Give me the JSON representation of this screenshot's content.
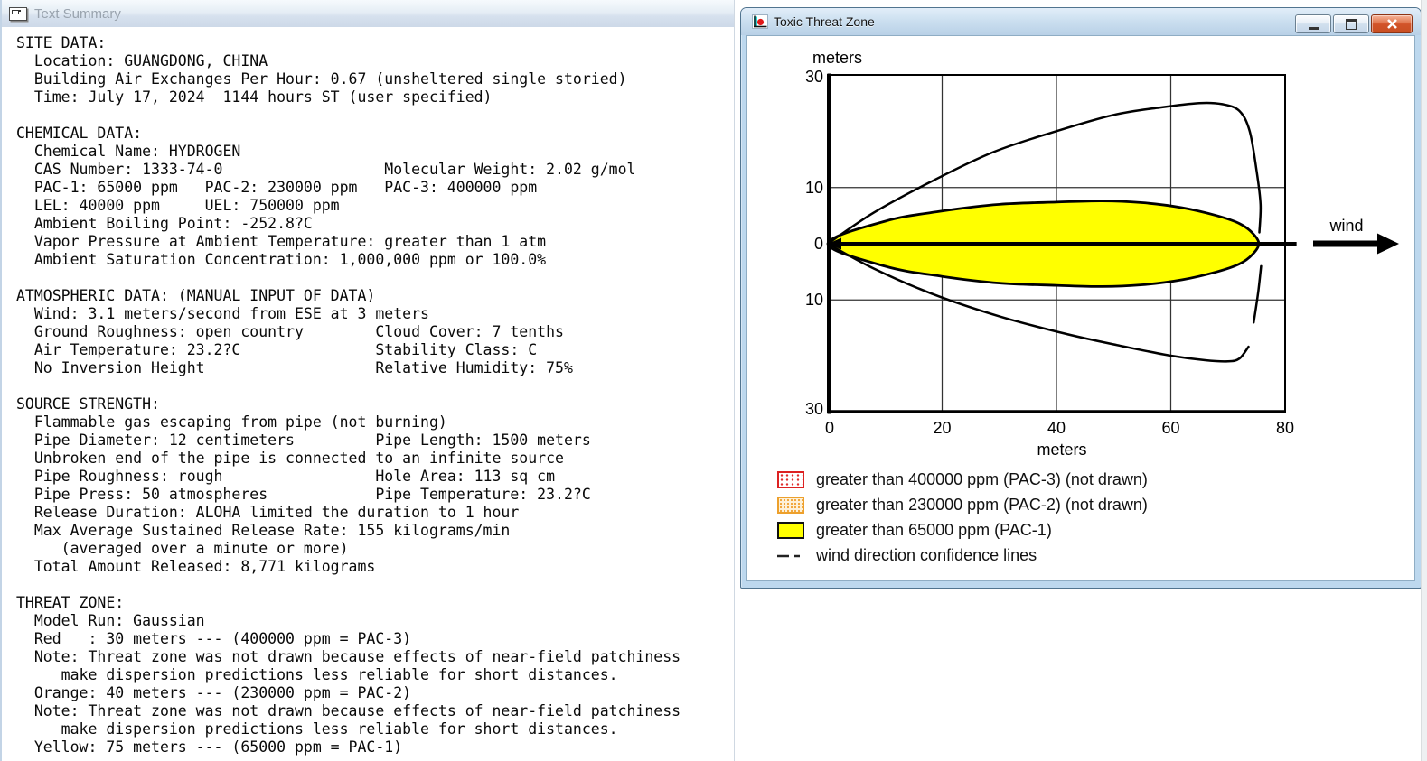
{
  "text_summary_window": {
    "title": "Text Summary",
    "content_lines": [
      "SITE DATA:",
      "  Location: GUANGDONG, CHINA",
      "  Building Air Exchanges Per Hour: 0.67 (unsheltered single storied)",
      "  Time: July 17, 2024  1144 hours ST (user specified)",
      "",
      "CHEMICAL DATA:",
      "  Chemical Name: HYDROGEN",
      "  CAS Number: 1333-74-0                  Molecular Weight: 2.02 g/mol",
      "  PAC-1: 65000 ppm   PAC-2: 230000 ppm   PAC-3: 400000 ppm",
      "  LEL: 40000 ppm     UEL: 750000 ppm",
      "  Ambient Boiling Point: -252.8?C",
      "  Vapor Pressure at Ambient Temperature: greater than 1 atm",
      "  Ambient Saturation Concentration: 1,000,000 ppm or 100.0%",
      "",
      "ATMOSPHERIC DATA: (MANUAL INPUT OF DATA)",
      "  Wind: 3.1 meters/second from ESE at 3 meters",
      "  Ground Roughness: open country        Cloud Cover: 7 tenths",
      "  Air Temperature: 23.2?C               Stability Class: C",
      "  No Inversion Height                   Relative Humidity: 75%",
      "",
      "SOURCE STRENGTH:",
      "  Flammable gas escaping from pipe (not burning)",
      "  Pipe Diameter: 12 centimeters         Pipe Length: 1500 meters",
      "  Unbroken end of the pipe is connected to an infinite source",
      "  Pipe Roughness: rough                 Hole Area: 113 sq cm",
      "  Pipe Press: 50 atmospheres            Pipe Temperature: 23.2?C",
      "  Release Duration: ALOHA limited the duration to 1 hour",
      "  Max Average Sustained Release Rate: 155 kilograms/min",
      "     (averaged over a minute or more)",
      "  Total Amount Released: 8,771 kilograms",
      "",
      "THREAT ZONE:",
      "  Model Run: Gaussian",
      "  Red   : 30 meters --- (400000 ppm = PAC-3)",
      "  Note: Threat zone was not drawn because effects of near-field patchiness",
      "     make dispersion predictions less reliable for short distances.",
      "  Orange: 40 meters --- (230000 ppm = PAC-2)",
      "  Note: Threat zone was not drawn because effects of near-field patchiness",
      "     make dispersion predictions less reliable for short distances.",
      "  Yellow: 75 meters --- (65000 ppm = PAC-1)"
    ]
  },
  "toxic_window": {
    "title": "Toxic Threat Zone"
  },
  "chart_data": {
    "type": "area",
    "title": "Toxic Threat Zone",
    "xlabel": "meters",
    "ylabel": "meters",
    "x_ticks": [
      "0",
      "20",
      "40",
      "60",
      "80"
    ],
    "y_tick_labels": [
      "30",
      "10",
      "0",
      "10",
      "30"
    ],
    "x_range_meters": [
      0,
      80
    ],
    "y_range_meters": [
      -30,
      30
    ],
    "grid": true,
    "wind_label": "wind",
    "centerline": {
      "from": [
        0,
        0
      ],
      "to": [
        82,
        0
      ]
    },
    "series": [
      {
        "name": "PAC-1 threat zone (greater than 65000 ppm)",
        "type": "filled-region",
        "fill": "#ffff00",
        "points_upper_half": [
          [
            0,
            0
          ],
          [
            10,
            4.0
          ],
          [
            20,
            5.8
          ],
          [
            30,
            7.0
          ],
          [
            40,
            7.4
          ],
          [
            48,
            7.6
          ],
          [
            55,
            7.3
          ],
          [
            62,
            6.4
          ],
          [
            68,
            5.0
          ],
          [
            72,
            3.6
          ],
          [
            74.3,
            1.9
          ],
          [
            75.4,
            0
          ]
        ]
      },
      {
        "name": "wind direction confidence line (upper)",
        "type": "line",
        "points": [
          [
            0,
            0
          ],
          [
            8,
            5.5
          ],
          [
            18,
            11.0
          ],
          [
            29,
            16.3
          ],
          [
            40,
            20.0
          ],
          [
            50,
            22.9
          ],
          [
            58,
            24.2
          ],
          [
            65,
            25.0
          ],
          [
            69,
            24.8
          ],
          [
            72,
            23.6
          ],
          [
            73.8,
            20.0
          ],
          [
            75.0,
            13.0
          ],
          [
            75.7,
            7.0
          ],
          [
            75.5,
            2.0
          ]
        ]
      },
      {
        "name": "wind direction confidence line (lower)",
        "type": "line",
        "segments": [
          [
            [
              0,
              0
            ],
            [
              8,
              -4.4
            ],
            [
              18,
              -8.8
            ],
            [
              30,
              -12.9
            ],
            [
              42,
              -16.1
            ],
            [
              52,
              -18.3
            ],
            [
              60,
              -19.9
            ],
            [
              66,
              -20.7
            ],
            [
              70,
              -20.9
            ],
            [
              72,
              -20.4
            ],
            [
              73.6,
              -18.3
            ]
          ],
          [
            [
              74.5,
              -14.0
            ],
            [
              75.3,
              -8.5
            ],
            [
              75.8,
              -4.0
            ]
          ]
        ]
      }
    ],
    "legend": [
      {
        "label": "greater than 400000 ppm (PAC-3) (not drawn)",
        "swatch": "red-stipple",
        "color": "#dd2222"
      },
      {
        "label": "greater than 230000 ppm (PAC-2) (not drawn)",
        "swatch": "orange-stipple",
        "color": "#f5a623"
      },
      {
        "label": "greater than 65000 ppm (PAC-1)",
        "swatch": "yellow-solid",
        "color": "#ffff00"
      },
      {
        "label": "wind direction confidence lines",
        "swatch": "dashed-line",
        "color": "#222222"
      }
    ]
  }
}
